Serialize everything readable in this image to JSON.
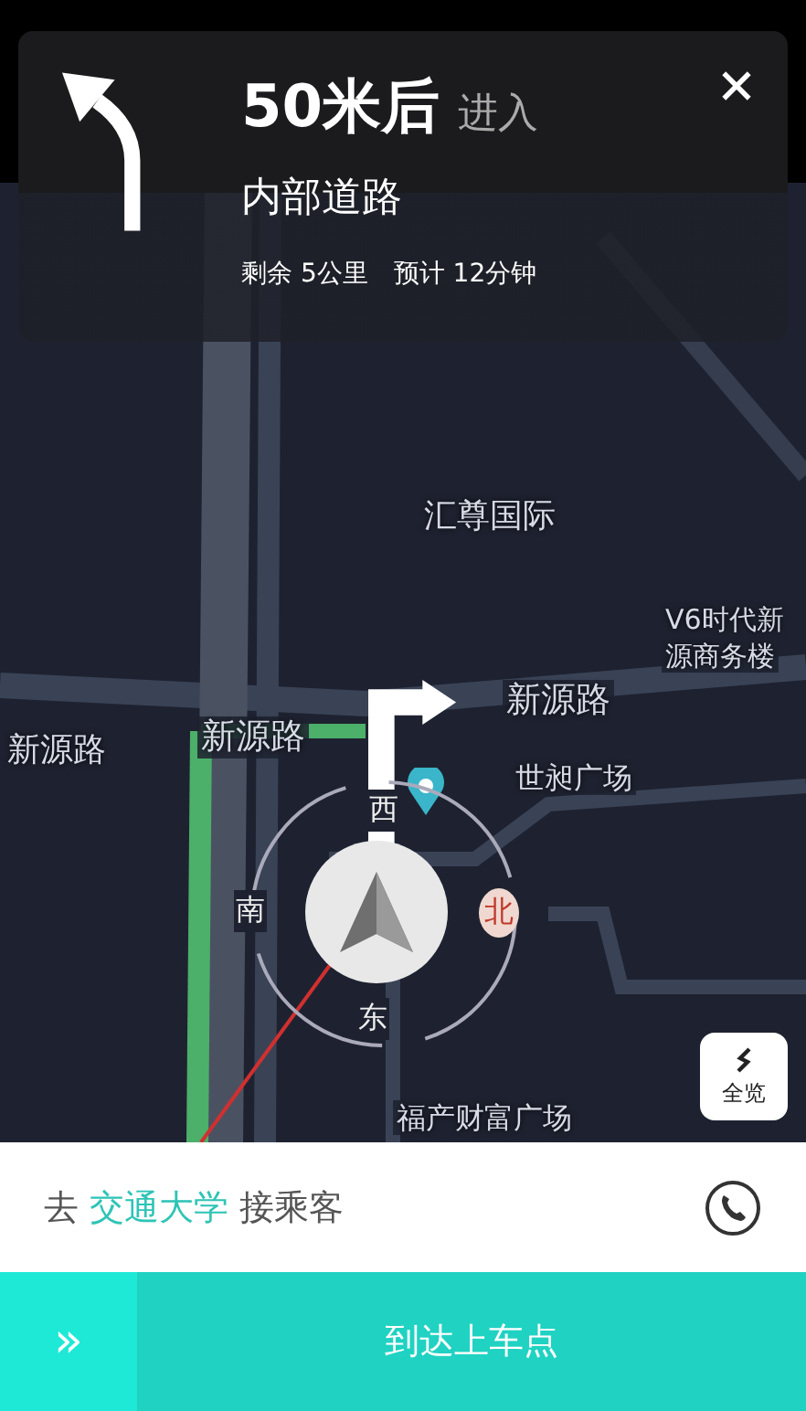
{
  "guidance": {
    "distance": "50米后",
    "action": "进入",
    "road": "内部道路",
    "remaining": "剩余 5公里",
    "eta": "预计 12分钟"
  },
  "map_labels": [
    "汇尊国际",
    "V6时代新",
    "源商务楼",
    "新源路",
    "新源路",
    "新源路",
    "世昶广场"
  ],
  "map_labels_bottom": [
    "福产财富广场"
  ],
  "compass": {
    "west": "西",
    "south": "南",
    "north": "北",
    "east": "东"
  },
  "overview_button": "全览",
  "task": {
    "prefix": "去",
    "destination": "交通大学",
    "suffix": "接乘客"
  },
  "slide_button": {
    "handle": "»",
    "label": "到达上车点"
  }
}
